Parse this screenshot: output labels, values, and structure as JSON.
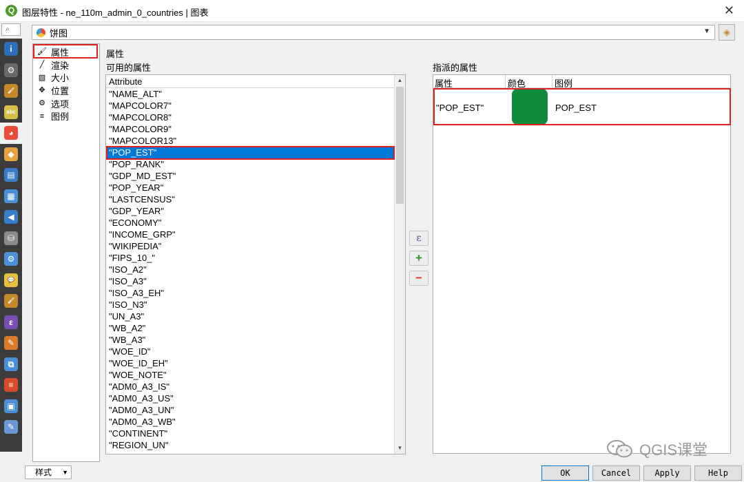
{
  "window": {
    "title": "图层特性 - ne_110m_admin_0_countries | 图表",
    "close_symbol": "✕"
  },
  "search": {
    "symbol": "⌕"
  },
  "sidebar": {
    "items": [
      {
        "name": "info-icon",
        "glyph": "i",
        "color": "#2a6fb8"
      },
      {
        "name": "source-icon",
        "glyph": "⚙",
        "color": "#6a6a6a"
      },
      {
        "name": "symbology-icon",
        "glyph": "🖌",
        "color": "#c48a2a"
      },
      {
        "name": "labels-icon",
        "glyph": "abc",
        "color": "#d8c048"
      },
      {
        "name": "diagrams-icon",
        "glyph": "◕",
        "color": "#e84b3c",
        "active": true
      },
      {
        "name": "3d-view-icon",
        "glyph": "◆",
        "color": "#e6a23c"
      },
      {
        "name": "fields-icon",
        "glyph": "▤",
        "color": "#3a7dc8"
      },
      {
        "name": "attributes-form-icon",
        "glyph": "▦",
        "color": "#4c8ed8"
      },
      {
        "name": "joins-icon",
        "glyph": "◀",
        "color": "#3a7dc8"
      },
      {
        "name": "auxiliary-storage-icon",
        "glyph": "⛁",
        "color": "#8a8a8a"
      },
      {
        "name": "actions-icon",
        "glyph": "⚙",
        "color": "#4a8fd6"
      },
      {
        "name": "display-icon",
        "glyph": "💬",
        "color": "#e6c040"
      },
      {
        "name": "rendering-icon",
        "glyph": "🖌",
        "color": "#c48a2a"
      },
      {
        "name": "variables-icon",
        "glyph": "ε",
        "color": "#7a4fb0"
      },
      {
        "name": "metadata-icon",
        "glyph": "✎",
        "color": "#d87a2a"
      },
      {
        "name": "dependencies-icon",
        "glyph": "⧉",
        "color": "#4a8fd6"
      },
      {
        "name": "legend-icon",
        "glyph": "≡",
        "color": "#d84a2a"
      },
      {
        "name": "qgis-server-icon",
        "glyph": "▣",
        "color": "#4a8fd6"
      },
      {
        "name": "digitizing-icon",
        "glyph": "✎",
        "color": "#6a9ad6"
      }
    ]
  },
  "renderer": {
    "selected": "饼图"
  },
  "nav": {
    "items": [
      {
        "label": "属性",
        "icon": "🖌",
        "name": "nav-item-attributes",
        "selected": true
      },
      {
        "label": "渲染",
        "icon": "╱",
        "name": "nav-item-rendering"
      },
      {
        "label": "大小",
        "icon": "▧",
        "name": "nav-item-size"
      },
      {
        "label": "位置",
        "icon": "✥",
        "name": "nav-item-placement"
      },
      {
        "label": "选项",
        "icon": "⚙",
        "name": "nav-item-options"
      },
      {
        "label": "图例",
        "icon": "≡",
        "name": "nav-item-legend"
      }
    ]
  },
  "panel": {
    "title": "属性",
    "available_title": "可用的属性",
    "assigned_title": "指派的属性"
  },
  "attributes": {
    "header": "Attribute",
    "rows": [
      "\"NAME_ALT\"",
      "\"MAPCOLOR7\"",
      "\"MAPCOLOR8\"",
      "\"MAPCOLOR9\"",
      "\"MAPCOLOR13\"",
      "\"POP_EST\"",
      "\"POP_RANK\"",
      "\"GDP_MD_EST\"",
      "\"POP_YEAR\"",
      "\"LASTCENSUS\"",
      "\"GDP_YEAR\"",
      "\"ECONOMY\"",
      "\"INCOME_GRP\"",
      "\"WIKIPEDIA\"",
      "\"FIPS_10_\"",
      "\"ISO_A2\"",
      "\"ISO_A3\"",
      "\"ISO_A3_EH\"",
      "\"ISO_N3\"",
      "\"UN_A3\"",
      "\"WB_A2\"",
      "\"WB_A3\"",
      "\"WOE_ID\"",
      "\"WOE_ID_EH\"",
      "\"WOE_NOTE\"",
      "\"ADM0_A3_IS\"",
      "\"ADM0_A3_US\"",
      "\"ADM0_A3_UN\"",
      "\"ADM0_A3_WB\"",
      "\"CONTINENT\"",
      "\"REGION_UN\""
    ],
    "selected_index": 5
  },
  "mid_buttons": {
    "expression": "ε",
    "add": "+",
    "remove": "−"
  },
  "assigned": {
    "headers": {
      "attribute": "属性",
      "color": "颜色",
      "legend": "图例"
    },
    "rows": [
      {
        "attribute": "\"POP_EST\"",
        "color": "#118c3c",
        "legend": "POP_EST"
      }
    ]
  },
  "watermark": {
    "text": "QGIS课堂"
  },
  "footer": {
    "style_label": "样式",
    "ok": "OK",
    "cancel": "Cancel",
    "apply": "Apply",
    "help": "Help"
  }
}
